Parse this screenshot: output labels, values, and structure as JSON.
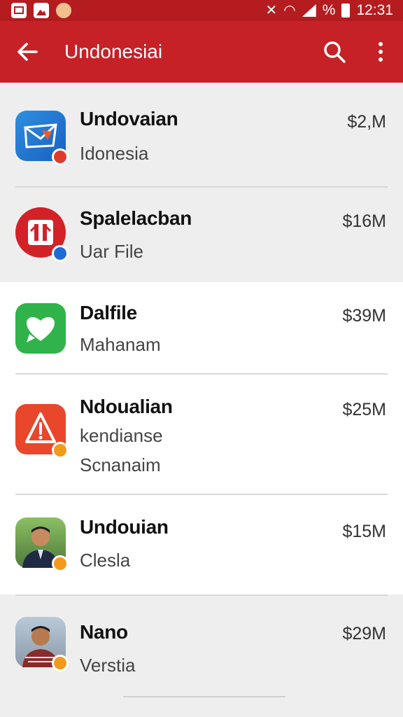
{
  "status_bar": {
    "time": "12:31",
    "battery_label": "%"
  },
  "app_bar": {
    "title": "Undonesiai"
  },
  "rows": [
    {
      "title": "Undovaian",
      "subtitle": "Idonesia",
      "amount": "$2,M",
      "icon": "app-icon-blue-envelope"
    },
    {
      "title": "Spalelacban",
      "subtitle": "Uar File",
      "amount": "$16M",
      "icon": "app-icon-red-document"
    },
    {
      "title": "Dalfile",
      "subtitle": "Mahanam",
      "amount": "$39M",
      "icon": "app-icon-green-chat-heart"
    },
    {
      "title": "Ndoualian",
      "subtitle": "kendianse",
      "subtitle2": "Scnanaim",
      "amount": "$25M",
      "icon": "app-icon-orange-alert"
    },
    {
      "title": "Undouian",
      "subtitle": "Clesla",
      "amount": "$15M",
      "icon": "avatar-photo"
    },
    {
      "title": "Nano",
      "subtitle": "Verstia",
      "amount": "$29M",
      "icon": "avatar-photo"
    }
  ],
  "colors": {
    "primary": "#c62127",
    "status_bar": "#b51c1f",
    "row_shade": "#eeeeee"
  }
}
